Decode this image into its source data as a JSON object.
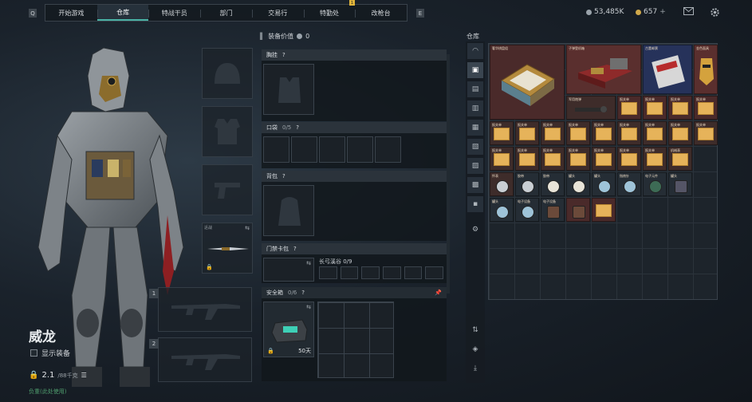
{
  "nav": {
    "tabs": [
      "开始游戏",
      "仓库",
      "特战干员",
      "部门",
      "交易行",
      "特勤处",
      "改枪台"
    ],
    "active_index": 1,
    "left_key": "Q",
    "right_key": "E",
    "badge": "1"
  },
  "currency": {
    "silver": "53,485K",
    "gold": "657"
  },
  "operator": {
    "name": "威龙",
    "show_equipment_label": "显示装备",
    "weight_value": "2.1",
    "weight_suffix": "/88千克",
    "tip": "负重(此处使用)"
  },
  "equipment": {
    "header_label": "装备价值",
    "header_value": "0",
    "chest_rig_label": "胸挂",
    "pocket_label": "口袋",
    "pocket_count": "0/5",
    "backpack_label": "背包",
    "keycard_label": "门禁卡包",
    "long_keys_label": "长弓溪谷 0/9",
    "safe_box_label": "安全箱",
    "safe_box_count": "0/6",
    "safe_box_days": "50天",
    "help_mark": "?"
  },
  "storage": {
    "title": "仓库",
    "sidebar_icons": [
      "helmet-icon",
      "bag-icon",
      "weapon-icon",
      "ammo-icon",
      "medical-icon",
      "key-icon",
      "collectible-icon",
      "settings-icon"
    ],
    "items": [
      {
        "label": "奢华棋盘组"
      },
      {
        "label": "子弹登机箱"
      },
      {
        "label": "古董邮票"
      },
      {
        "label": "金色面具"
      },
      {
        "label": "军用炮弹"
      },
      {
        "label": "报关单"
      },
      {
        "label": "报关单"
      },
      {
        "label": "报关单"
      },
      {
        "label": "报关单"
      },
      {
        "label": "报关单"
      },
      {
        "label": "报关单"
      },
      {
        "label": "报关单"
      },
      {
        "label": "报关单"
      },
      {
        "label": "报关单"
      },
      {
        "label": "报关单"
      },
      {
        "label": "报关单"
      },
      {
        "label": "报关单"
      },
      {
        "label": "报关单"
      },
      {
        "label": "报关单"
      },
      {
        "label": "报关单"
      },
      {
        "label": "报关单"
      },
      {
        "label": "报关单"
      },
      {
        "label": "报关单"
      },
      {
        "label": "报关单"
      },
      {
        "label": "报关单"
      },
      {
        "label": "机械表"
      },
      {
        "label": "怀表"
      },
      {
        "label": "胶带"
      },
      {
        "label": "胶带"
      },
      {
        "label": "罐头"
      },
      {
        "label": "罐头"
      },
      {
        "label": "指南针"
      },
      {
        "label": "电子元件"
      },
      {
        "label": "罐头"
      },
      {
        "label": "罐头"
      },
      {
        "label": "电子设备"
      },
      {
        "label": "电子设备"
      }
    ]
  }
}
